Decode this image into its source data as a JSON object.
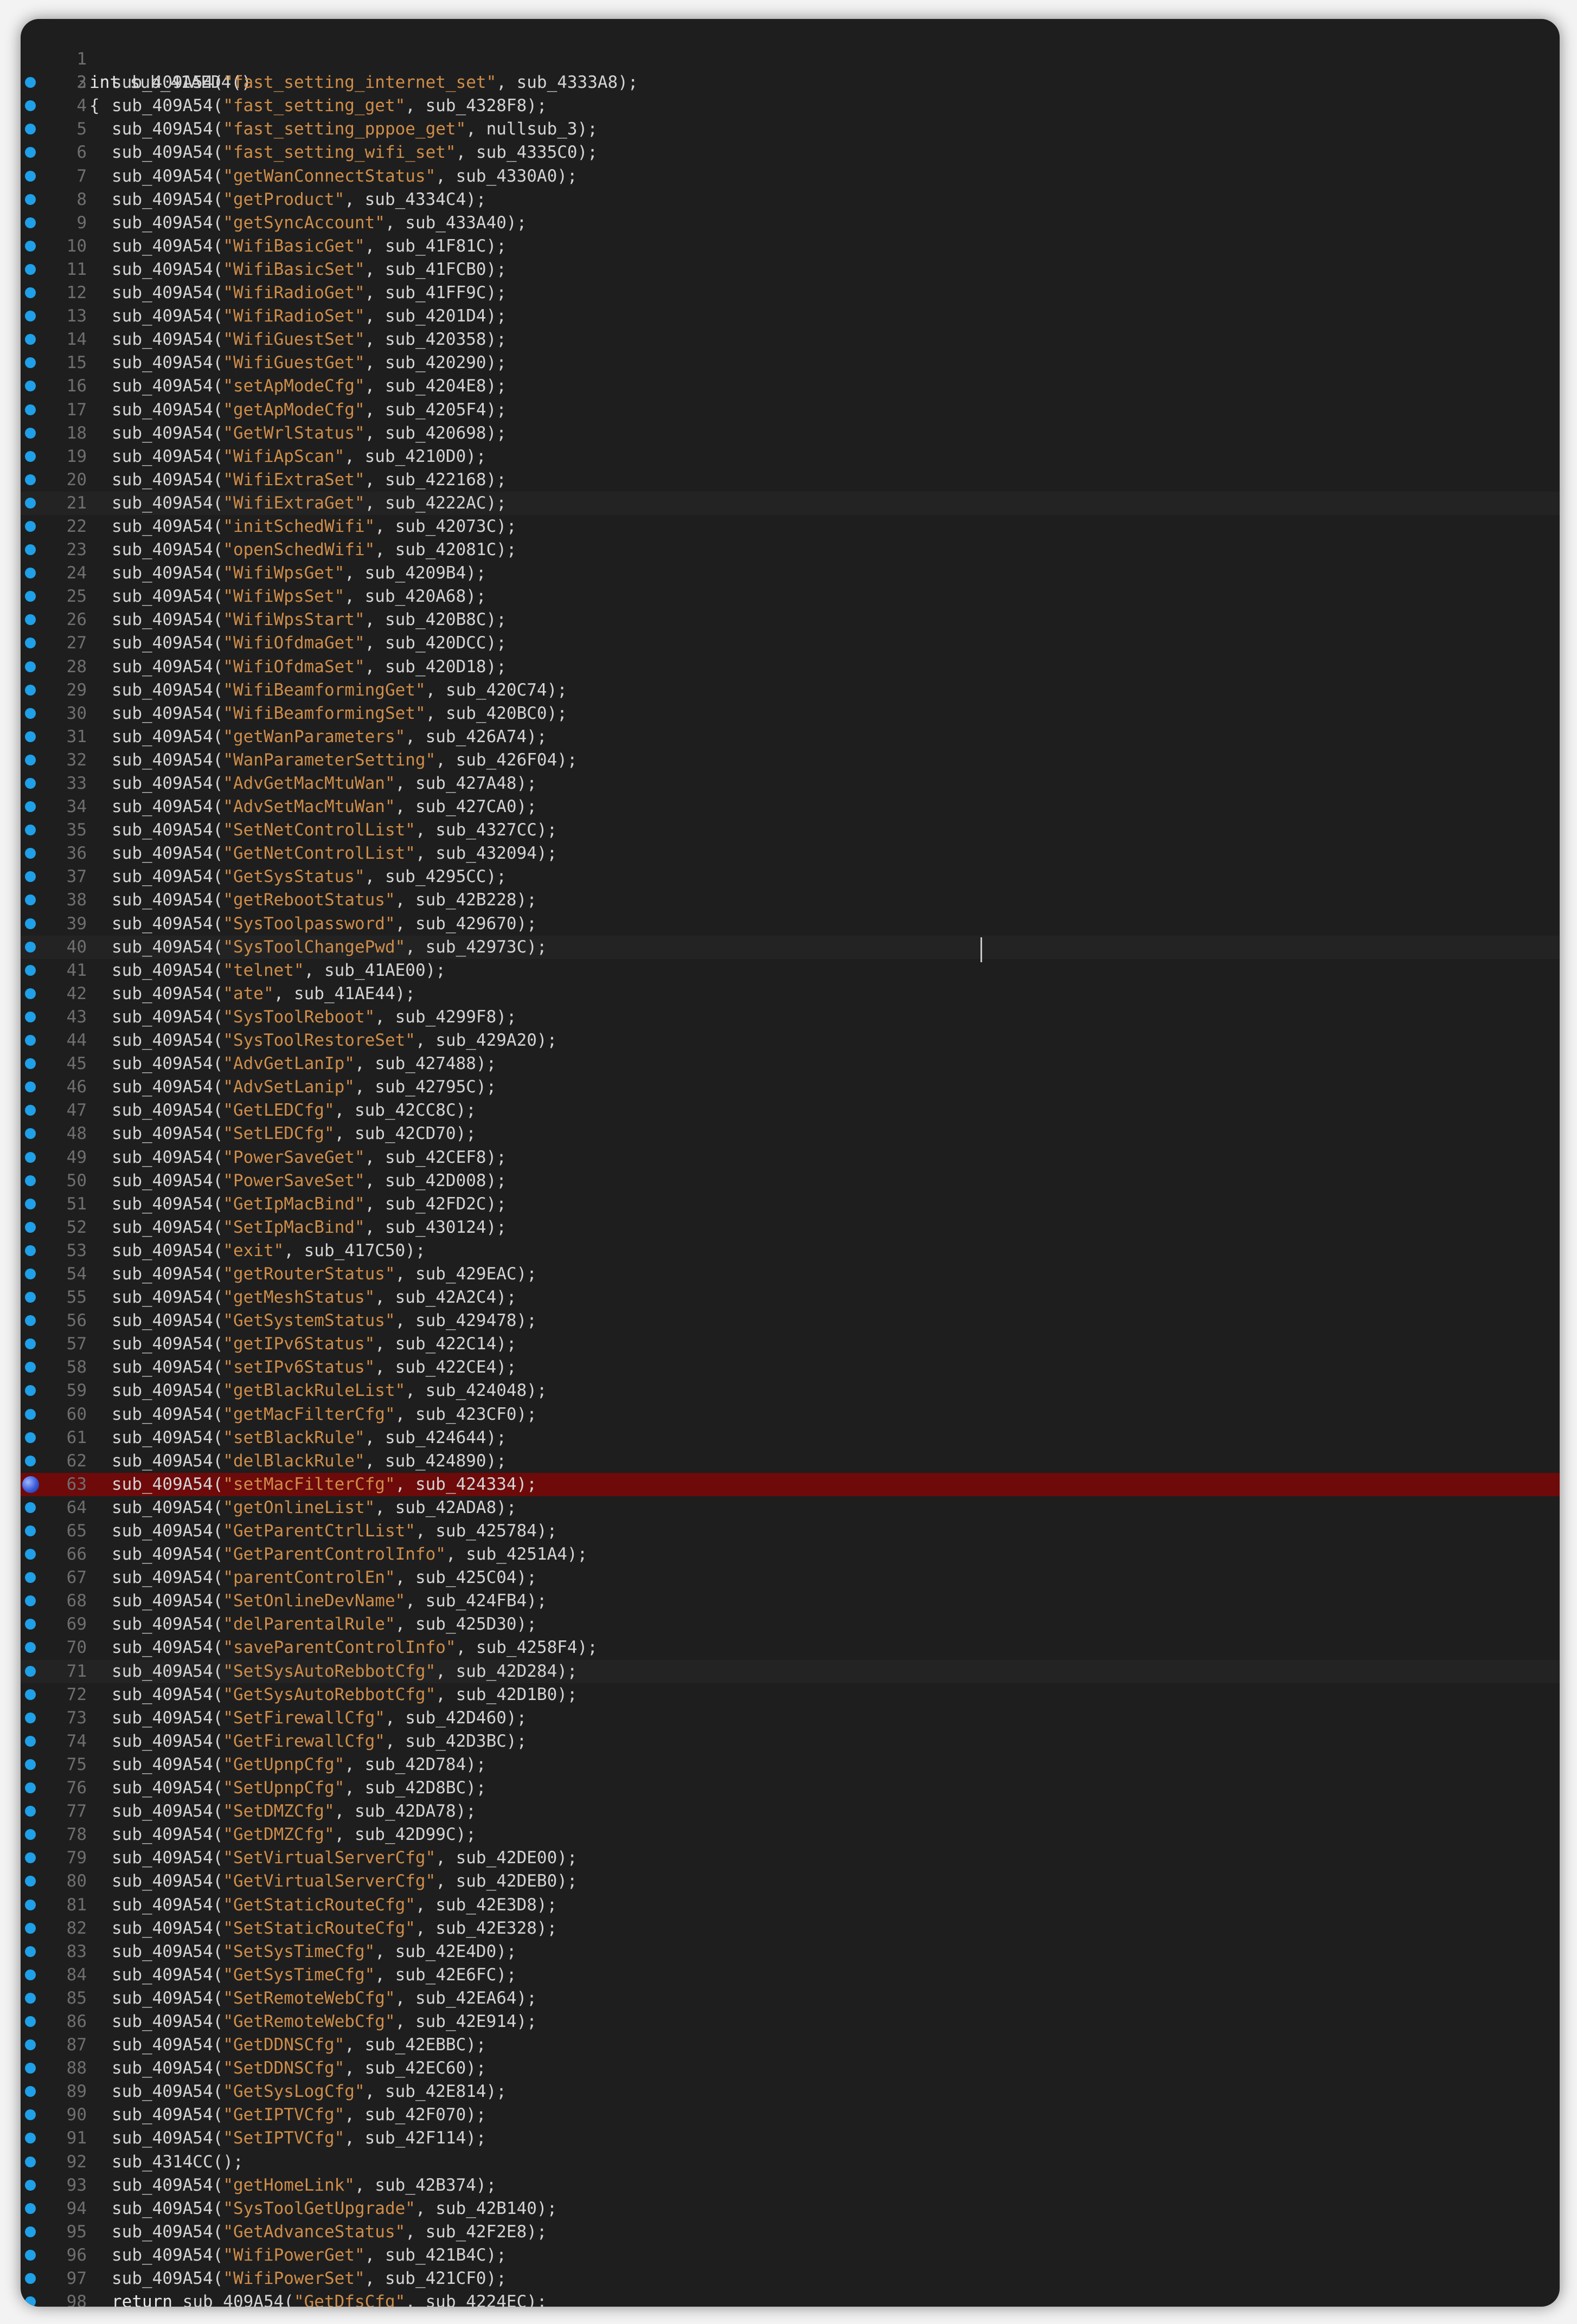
{
  "editor": {
    "header": {
      "keyword": "int",
      "name": "sub_41AED4",
      "suffix": "()"
    },
    "open_brace": "{",
    "call_name": "sub_409A54",
    "lines": [
      {
        "n": "3",
        "s": "fast_setting_internet_set",
        "h": "sub_4333A8"
      },
      {
        "n": "4",
        "s": "fast_setting_get",
        "h": "sub_4328F8"
      },
      {
        "n": "5",
        "s": "fast_setting_pppoe_get",
        "h": "nullsub_3"
      },
      {
        "n": "6",
        "s": "fast_setting_wifi_set",
        "h": "sub_4335C0"
      },
      {
        "n": "7",
        "s": "getWanConnectStatus",
        "h": "sub_4330A0"
      },
      {
        "n": "8",
        "s": "getProduct",
        "h": "sub_4334C4"
      },
      {
        "n": "9",
        "s": "getSyncAccount",
        "h": "sub_433A40"
      },
      {
        "n": "10",
        "s": "WifiBasicGet",
        "h": "sub_41F81C"
      },
      {
        "n": "11",
        "s": "WifiBasicSet",
        "h": "sub_41FCB0"
      },
      {
        "n": "12",
        "s": "WifiRadioGet",
        "h": "sub_41FF9C"
      },
      {
        "n": "13",
        "s": "WifiRadioSet",
        "h": "sub_4201D4"
      },
      {
        "n": "14",
        "s": "WifiGuestSet",
        "h": "sub_420358"
      },
      {
        "n": "15",
        "s": "WifiGuestGet",
        "h": "sub_420290"
      },
      {
        "n": "16",
        "s": "setApModeCfg",
        "h": "sub_4204E8"
      },
      {
        "n": "17",
        "s": "getApModeCfg",
        "h": "sub_4205F4"
      },
      {
        "n": "18",
        "s": "GetWrlStatus",
        "h": "sub_420698"
      },
      {
        "n": "19",
        "s": "WifiApScan",
        "h": "sub_4210D0"
      },
      {
        "n": "20",
        "s": "WifiExtraSet",
        "h": "sub_422168"
      },
      {
        "n": "21",
        "s": "WifiExtraGet",
        "h": "sub_4222AC"
      },
      {
        "n": "22",
        "s": "initSchedWifi",
        "h": "sub_42073C"
      },
      {
        "n": "23",
        "s": "openSchedWifi",
        "h": "sub_42081C"
      },
      {
        "n": "24",
        "s": "WifiWpsGet",
        "h": "sub_4209B4"
      },
      {
        "n": "25",
        "s": "WifiWpsSet",
        "h": "sub_420A68"
      },
      {
        "n": "26",
        "s": "WifiWpsStart",
        "h": "sub_420B8C"
      },
      {
        "n": "27",
        "s": "WifiOfdmaGet",
        "h": "sub_420DCC"
      },
      {
        "n": "28",
        "s": "WifiOfdmaSet",
        "h": "sub_420D18"
      },
      {
        "n": "29",
        "s": "WifiBeamformingGet",
        "h": "sub_420C74"
      },
      {
        "n": "30",
        "s": "WifiBeamformingSet",
        "h": "sub_420BC0"
      },
      {
        "n": "31",
        "s": "getWanParameters",
        "h": "sub_426A74"
      },
      {
        "n": "32",
        "s": "WanParameterSetting",
        "h": "sub_426F04"
      },
      {
        "n": "33",
        "s": "AdvGetMacMtuWan",
        "h": "sub_427A48"
      },
      {
        "n": "34",
        "s": "AdvSetMacMtuWan",
        "h": "sub_427CA0"
      },
      {
        "n": "35",
        "s": "SetNetControlList",
        "h": "sub_4327CC"
      },
      {
        "n": "36",
        "s": "GetNetControlList",
        "h": "sub_432094"
      },
      {
        "n": "37",
        "s": "GetSysStatus",
        "h": "sub_4295CC"
      },
      {
        "n": "38",
        "s": "getRebootStatus",
        "h": "sub_42B228"
      },
      {
        "n": "39",
        "s": "SysToolpassword",
        "h": "sub_429670"
      },
      {
        "n": "40",
        "s": "SysToolChangePwd",
        "h": "sub_42973C"
      },
      {
        "n": "41",
        "s": "telnet",
        "h": "sub_41AE00"
      },
      {
        "n": "42",
        "s": "ate",
        "h": "sub_41AE44"
      },
      {
        "n": "43",
        "s": "SysToolReboot",
        "h": "sub_4299F8"
      },
      {
        "n": "44",
        "s": "SysToolRestoreSet",
        "h": "sub_429A20"
      },
      {
        "n": "45",
        "s": "AdvGetLanIp",
        "h": "sub_427488"
      },
      {
        "n": "46",
        "s": "AdvSetLanip",
        "h": "sub_42795C"
      },
      {
        "n": "47",
        "s": "GetLEDCfg",
        "h": "sub_42CC8C"
      },
      {
        "n": "48",
        "s": "SetLEDCfg",
        "h": "sub_42CD70"
      },
      {
        "n": "49",
        "s": "PowerSaveGet",
        "h": "sub_42CEF8"
      },
      {
        "n": "50",
        "s": "PowerSaveSet",
        "h": "sub_42D008"
      },
      {
        "n": "51",
        "s": "GetIpMacBind",
        "h": "sub_42FD2C"
      },
      {
        "n": "52",
        "s": "SetIpMacBind",
        "h": "sub_430124"
      },
      {
        "n": "53",
        "s": "exit",
        "h": "sub_417C50"
      },
      {
        "n": "54",
        "s": "getRouterStatus",
        "h": "sub_429EAC"
      },
      {
        "n": "55",
        "s": "getMeshStatus",
        "h": "sub_42A2C4"
      },
      {
        "n": "56",
        "s": "GetSystemStatus",
        "h": "sub_429478"
      },
      {
        "n": "57",
        "s": "getIPv6Status",
        "h": "sub_422C14"
      },
      {
        "n": "58",
        "s": "setIPv6Status",
        "h": "sub_422CE4"
      },
      {
        "n": "59",
        "s": "getBlackRuleList",
        "h": "sub_424048"
      },
      {
        "n": "60",
        "s": "getMacFilterCfg",
        "h": "sub_423CF0"
      },
      {
        "n": "61",
        "s": "setBlackRule",
        "h": "sub_424644"
      },
      {
        "n": "62",
        "s": "delBlackRule",
        "h": "sub_424890"
      },
      {
        "n": "63",
        "s": "setMacFilterCfg",
        "h": "sub_424334"
      },
      {
        "n": "64",
        "s": "getOnlineList",
        "h": "sub_42ADA8"
      },
      {
        "n": "65",
        "s": "GetParentCtrlList",
        "h": "sub_425784"
      },
      {
        "n": "66",
        "s": "GetParentControlInfo",
        "h": "sub_4251A4"
      },
      {
        "n": "67",
        "s": "parentControlEn",
        "h": "sub_425C04"
      },
      {
        "n": "68",
        "s": "SetOnlineDevName",
        "h": "sub_424FB4"
      },
      {
        "n": "69",
        "s": "delParentalRule",
        "h": "sub_425D30"
      },
      {
        "n": "70",
        "s": "saveParentControlInfo",
        "h": "sub_4258F4"
      },
      {
        "n": "71",
        "s": "SetSysAutoRebbotCfg",
        "h": "sub_42D284"
      },
      {
        "n": "72",
        "s": "GetSysAutoRebbotCfg",
        "h": "sub_42D1B0"
      },
      {
        "n": "73",
        "s": "SetFirewallCfg",
        "h": "sub_42D460"
      },
      {
        "n": "74",
        "s": "GetFirewallCfg",
        "h": "sub_42D3BC"
      },
      {
        "n": "75",
        "s": "GetUpnpCfg",
        "h": "sub_42D784"
      },
      {
        "n": "76",
        "s": "SetUpnpCfg",
        "h": "sub_42D8BC"
      },
      {
        "n": "77",
        "s": "SetDMZCfg",
        "h": "sub_42DA78"
      },
      {
        "n": "78",
        "s": "GetDMZCfg",
        "h": "sub_42D99C"
      },
      {
        "n": "79",
        "s": "SetVirtualServerCfg",
        "h": "sub_42DE00"
      },
      {
        "n": "80",
        "s": "GetVirtualServerCfg",
        "h": "sub_42DEB0"
      },
      {
        "n": "81",
        "s": "GetStaticRouteCfg",
        "h": "sub_42E3D8"
      },
      {
        "n": "82",
        "s": "SetStaticRouteCfg",
        "h": "sub_42E328"
      },
      {
        "n": "83",
        "s": "SetSysTimeCfg",
        "h": "sub_42E4D0"
      },
      {
        "n": "84",
        "s": "GetSysTimeCfg",
        "h": "sub_42E6FC"
      },
      {
        "n": "85",
        "s": "SetRemoteWebCfg",
        "h": "sub_42EA64"
      },
      {
        "n": "86",
        "s": "GetRemoteWebCfg",
        "h": "sub_42E914"
      },
      {
        "n": "87",
        "s": "GetDDNSCfg",
        "h": "sub_42EBBC"
      },
      {
        "n": "88",
        "s": "SetDDNSCfg",
        "h": "sub_42EC60"
      },
      {
        "n": "89",
        "s": "GetSysLogCfg",
        "h": "sub_42E814"
      },
      {
        "n": "90",
        "s": "GetIPTVCfg",
        "h": "sub_42F070"
      },
      {
        "n": "91",
        "s": "SetIPTVCfg",
        "h": "sub_42F114"
      },
      {
        "n": "92",
        "raw": "sub_4314CC();"
      },
      {
        "n": "93",
        "s": "getHomeLink",
        "h": "sub_42B374"
      },
      {
        "n": "94",
        "s": "SysToolGetUpgrade",
        "h": "sub_42B140"
      },
      {
        "n": "95",
        "s": "GetAdvanceStatus",
        "h": "sub_42F2E8"
      },
      {
        "n": "96",
        "s": "WifiPowerGet",
        "h": "sub_421B4C"
      },
      {
        "n": "97",
        "s": "WifiPowerSet",
        "h": "sub_421CF0"
      },
      {
        "n": "98",
        "s": "GetDfsCfg",
        "h": "sub_4224EC",
        "ret": "return"
      }
    ]
  },
  "colors": {
    "background": "#1e1e1e",
    "string": "#ce8d4a",
    "text": "#d4d4d4",
    "line_number": "#6f6f6f",
    "breakpoint": "#1fa0e8",
    "current_line": "#6e0a0a"
  }
}
